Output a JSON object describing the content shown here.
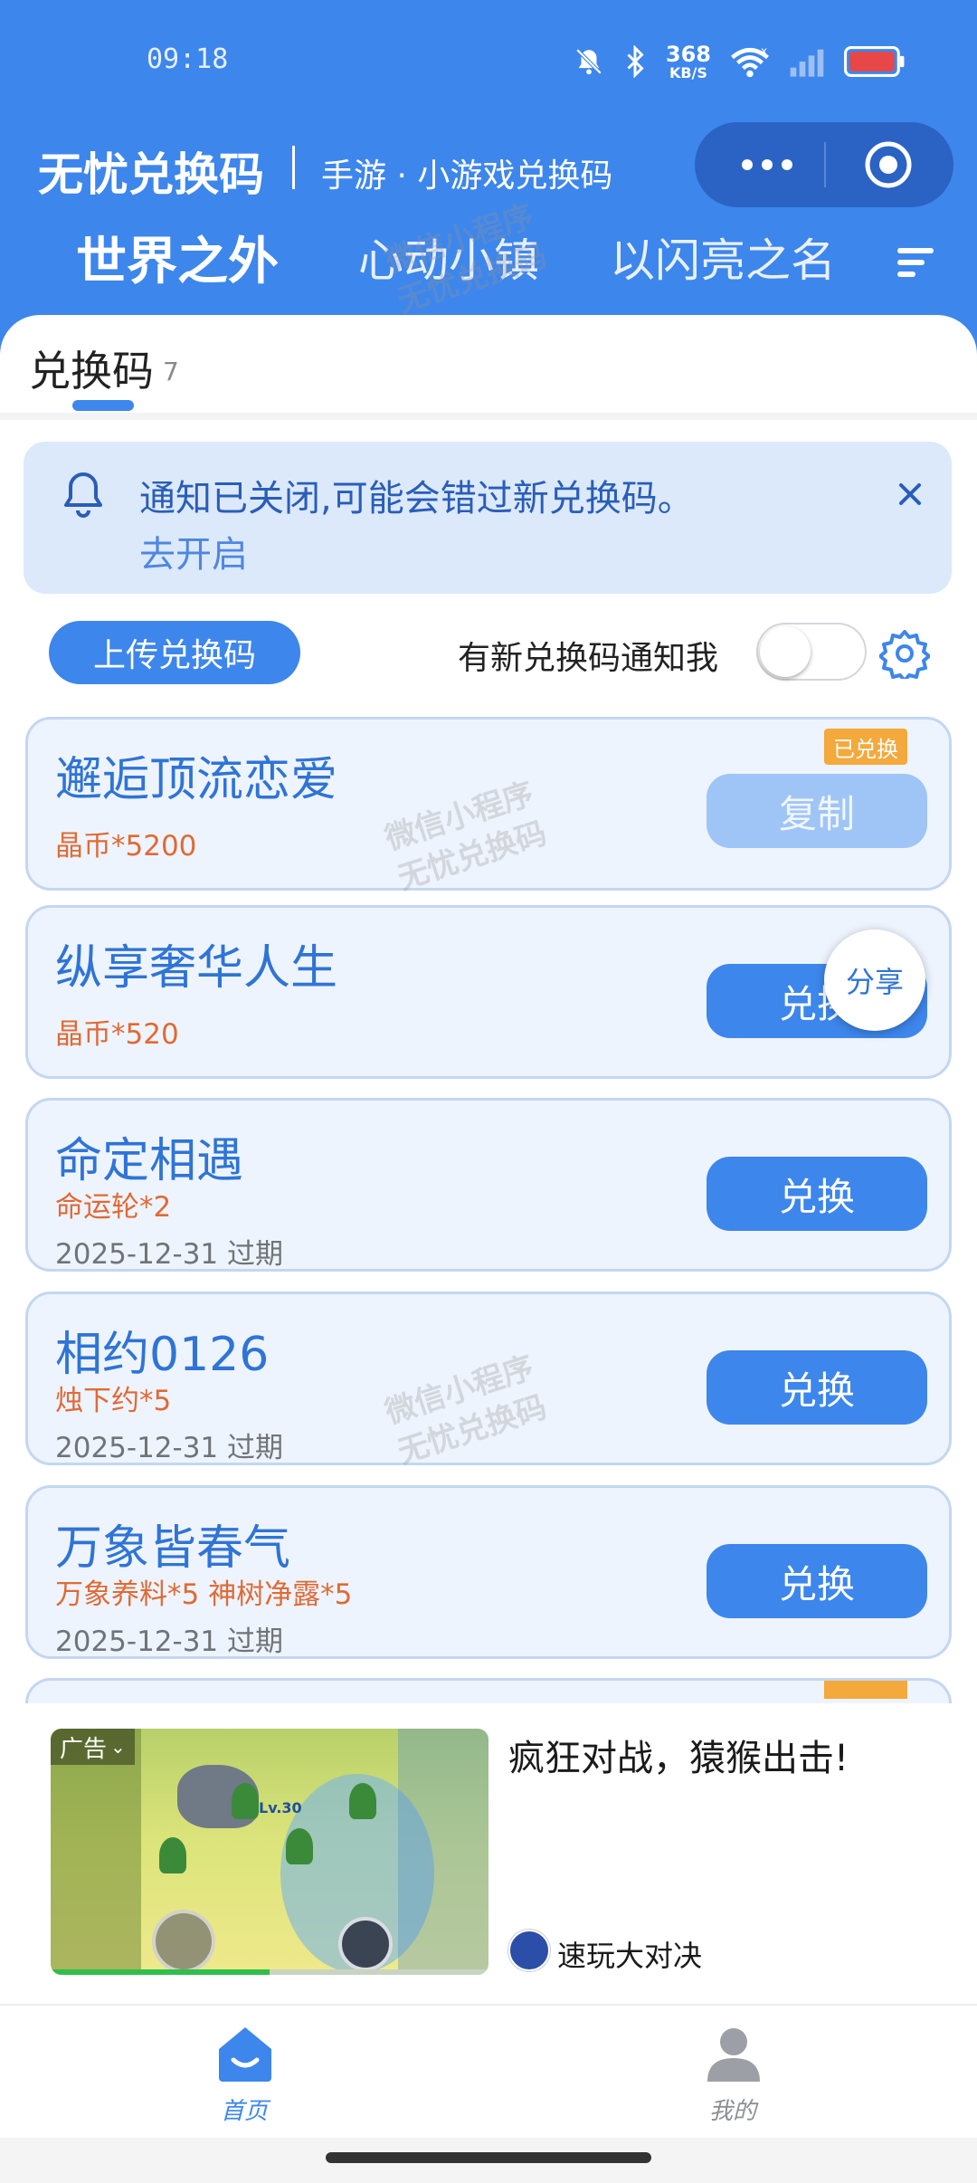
{
  "status_bar": {
    "time": "09:18",
    "net_speed_value": "368",
    "net_speed_unit": "KB/S"
  },
  "header": {
    "app_title": "无忧兑换码",
    "app_subtitle": "手游 · 小游戏兑换码",
    "colors": {
      "primary": "#3d86ec",
      "capsule": "#2a63c4"
    }
  },
  "game_tabs": [
    {
      "label": "世界之外",
      "active": true
    },
    {
      "label": "心动小镇",
      "active": false
    },
    {
      "label": "以闪亮之名",
      "active": false
    }
  ],
  "section": {
    "tab_label": "兑换码",
    "tab_count": "7"
  },
  "notice": {
    "text": "通知已关闭,可能会错过新兑换码。",
    "link": "去开启"
  },
  "actions": {
    "upload_label": "上传兑换码",
    "notify_label": "有新兑换码通知我",
    "notify_enabled": false
  },
  "codes": [
    {
      "title": "邂逅顶流恋爱",
      "reward": "晶币*5200",
      "expiry": "",
      "button": "复制",
      "badge": "已兑换"
    },
    {
      "title": "纵享奢华人生",
      "reward": "晶币*520",
      "expiry": "",
      "button": "兑换",
      "share": "分享"
    },
    {
      "title": "命定相遇",
      "reward": "命运轮*2",
      "expiry": "2025-12-31 过期",
      "button": "兑换"
    },
    {
      "title": "相约0126",
      "reward": "烛下约*5",
      "expiry": "2025-12-31 过期",
      "button": "兑换"
    },
    {
      "title": "万象皆春气",
      "reward": "万象养料*5 神树净露*5",
      "expiry": "2025-12-31 过期",
      "button": "兑换"
    }
  ],
  "watermark": {
    "line1": "微信小程序",
    "line2": "无忧兑换码"
  },
  "ad": {
    "label": "广告",
    "title": "疯狂对战，猿猴出击!",
    "sponsor": "速玩大对决",
    "game_level_text": "Lv.30",
    "video_progress": 0.5
  },
  "tabbar": {
    "home_label": "首页",
    "mine_label": "我的"
  },
  "icons": {
    "mute": "bell-off-icon",
    "bluetooth": "bluetooth-icon",
    "wifi": "wifi-icon",
    "signal": "signal-icon",
    "battery": "battery-icon",
    "more": "more-dots-icon",
    "close_mini": "target-close-icon",
    "menu": "sort-menu-icon",
    "bell": "bell-icon",
    "close": "close-icon",
    "settings": "gear-icon",
    "home": "home-icon",
    "user": "user-icon"
  }
}
